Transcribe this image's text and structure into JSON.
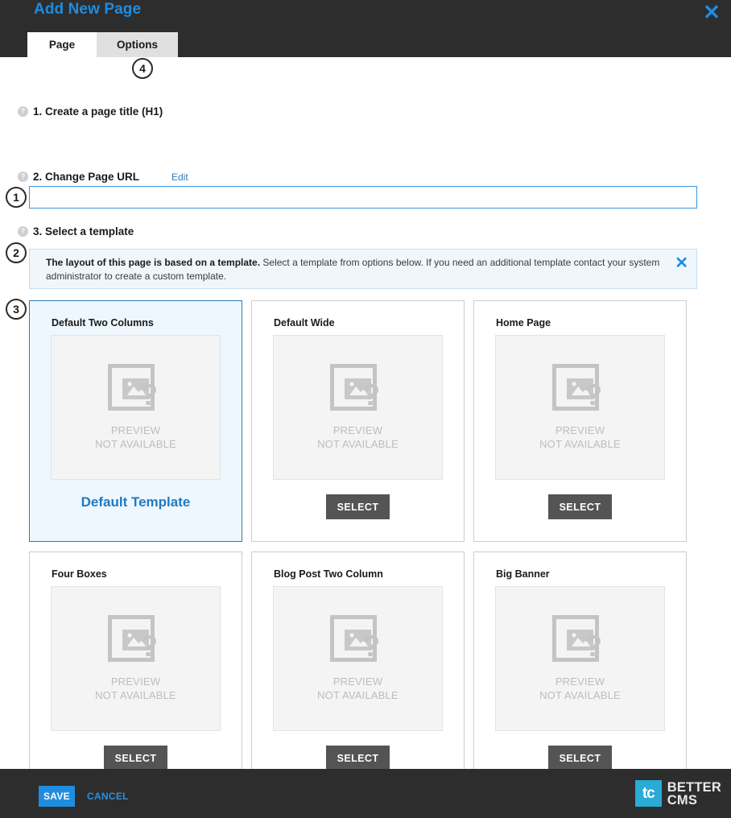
{
  "header": {
    "title": "Add New Page",
    "close_label": "✕",
    "tabs": [
      {
        "label": "Page",
        "active": true
      },
      {
        "label": "Options",
        "active": false
      }
    ]
  },
  "markers": {
    "m1": "1",
    "m2": "2",
    "m3": "3",
    "m4": "4"
  },
  "help_glyph": "?",
  "steps": {
    "step1": {
      "label": "1. Create a page title (H1)"
    },
    "step2": {
      "label": "2. Change Page URL",
      "edit_link": "Edit"
    },
    "step3": {
      "label": "3. Select a template"
    }
  },
  "title_input": {
    "value": "",
    "placeholder": ""
  },
  "info_banner": {
    "strong_text": "The layout of this page is based on a template.",
    "rest_text": " Select a template from options below. If you need an additional template contact your system administrator to create a custom template.",
    "close_label": "✕"
  },
  "preview": {
    "line1": "PREVIEW",
    "line2": "NOT AVAILABLE",
    "question_glyph": "?"
  },
  "templates": [
    {
      "name": "Default Two Columns",
      "selected": true,
      "action_label": "Default Template"
    },
    {
      "name": "Default Wide",
      "selected": false,
      "action_label": "SELECT"
    },
    {
      "name": "Home Page",
      "selected": false,
      "action_label": "SELECT"
    },
    {
      "name": "Four Boxes",
      "selected": false,
      "action_label": "SELECT"
    },
    {
      "name": "Blog Post Two Column",
      "selected": false,
      "action_label": "SELECT"
    },
    {
      "name": "Big Banner",
      "selected": false,
      "action_label": "SELECT"
    }
  ],
  "footer": {
    "save_label": "SAVE",
    "cancel_label": "CANCEL",
    "logo_mark": "tc",
    "logo_line1": "BETTER",
    "logo_line2": "CMS"
  },
  "colors": {
    "accent_blue": "#1f8ce0",
    "header_bg": "#2d2d2d",
    "selected_card_bg": "#eef7fd",
    "banner_bg": "#eff7fd",
    "select_button_bg": "#545454",
    "logo_cyan": "#29abd6"
  }
}
